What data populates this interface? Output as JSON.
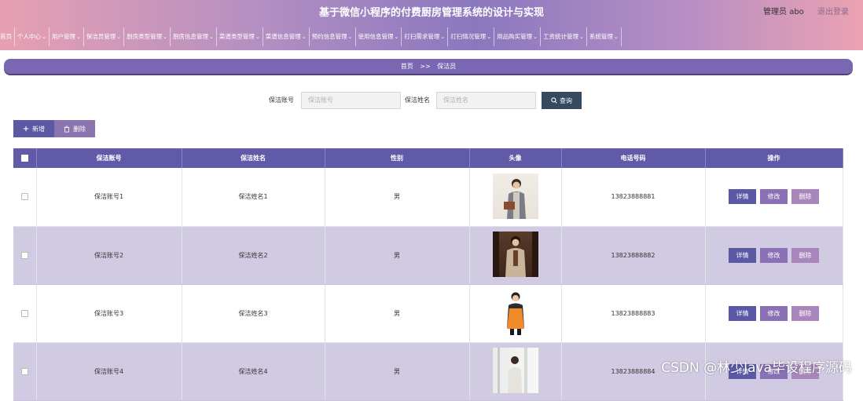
{
  "header": {
    "title": "基于微信小程序的付费厨房管理系统的设计与实现",
    "user_label": "管理员 abo",
    "logout_label": "退出登录"
  },
  "nav": {
    "items": [
      {
        "label": "首页",
        "has_dropdown": false
      },
      {
        "label": "个人中心",
        "has_dropdown": true
      },
      {
        "label": "用户管理",
        "has_dropdown": true
      },
      {
        "label": "保洁员管理",
        "has_dropdown": true
      },
      {
        "label": "厨房类型管理",
        "has_dropdown": true
      },
      {
        "label": "厨房信息管理",
        "has_dropdown": true
      },
      {
        "label": "菜谱类型管理",
        "has_dropdown": true
      },
      {
        "label": "菜谱信息管理",
        "has_dropdown": true
      },
      {
        "label": "预约信息管理",
        "has_dropdown": true
      },
      {
        "label": "使用信息管理",
        "has_dropdown": true
      },
      {
        "label": "打扫需求管理",
        "has_dropdown": true
      },
      {
        "label": "打扫情况管理",
        "has_dropdown": true
      },
      {
        "label": "用品购买管理",
        "has_dropdown": true
      },
      {
        "label": "工资统计管理",
        "has_dropdown": true
      },
      {
        "label": "系统管理",
        "has_dropdown": true
      }
    ],
    "dropdown_icon": "chevron-down-icon"
  },
  "breadcrumb": {
    "home": "首页",
    "separator": ">>",
    "current": "保洁员"
  },
  "search": {
    "account_label": "保洁账号",
    "account_placeholder": "保洁账号",
    "name_label": "保洁姓名",
    "name_placeholder": "保洁姓名",
    "query_label": "查询",
    "query_icon": "search-icon"
  },
  "actions": {
    "add_label": "新增",
    "add_icon": "plus-icon",
    "delete_label": "删除",
    "delete_icon": "trash-icon"
  },
  "table": {
    "columns": [
      "保洁账号",
      "保洁姓名",
      "性别",
      "头像",
      "电话号码",
      "操作"
    ],
    "rows": [
      {
        "account": "保洁账号1",
        "name": "保洁姓名1",
        "gender": "男",
        "phone": "13823888881",
        "photo": "cleaner-photo-1"
      },
      {
        "account": "保洁账号2",
        "name": "保洁姓名2",
        "gender": "男",
        "phone": "13823888882",
        "photo": "cleaner-photo-2"
      },
      {
        "account": "保洁账号3",
        "name": "保洁姓名3",
        "gender": "男",
        "phone": "13823888883",
        "photo": "cleaner-photo-3"
      },
      {
        "account": "保洁账号4",
        "name": "保洁姓名4",
        "gender": "男",
        "phone": "13823888884",
        "photo": "cleaner-photo-4"
      }
    ],
    "row_actions": {
      "detail": "详情",
      "edit": "修改",
      "delete": "删除"
    }
  },
  "colors": {
    "header_gradient": [
      "#e7a0b2",
      "#8a78be",
      "#eba2b2"
    ],
    "table_header": "#605aa8",
    "even_row": "#d1cae3",
    "query_button": "#354a5e"
  },
  "watermark": "CSDN @林少Java毕设程序源码"
}
